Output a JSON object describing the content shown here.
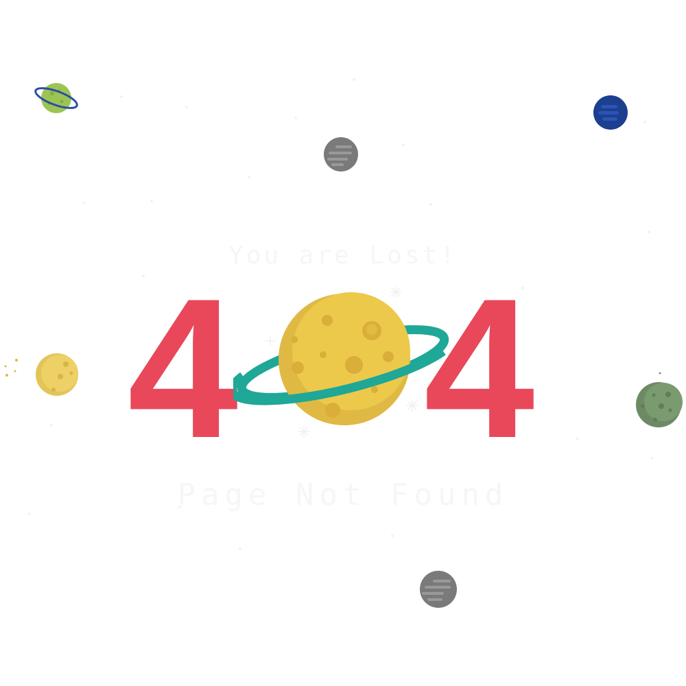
{
  "error": {
    "subtitle": "You are Lost!",
    "code_first_digit": "4",
    "code_last_digit": "4",
    "message": "Page Not Found"
  },
  "colors": {
    "background": "#ffffff",
    "digits": "#e8485a",
    "center_planet": "#ecc94b",
    "center_ring": "#1fa797",
    "faint_text": "#f6f6f6"
  },
  "icons": [
    "ringed-green-planet-icon",
    "blue-planet-icon",
    "gray-planet-icon",
    "yellow-moon-icon",
    "green-planet-icon",
    "ringed-yellow-planet-icon"
  ]
}
